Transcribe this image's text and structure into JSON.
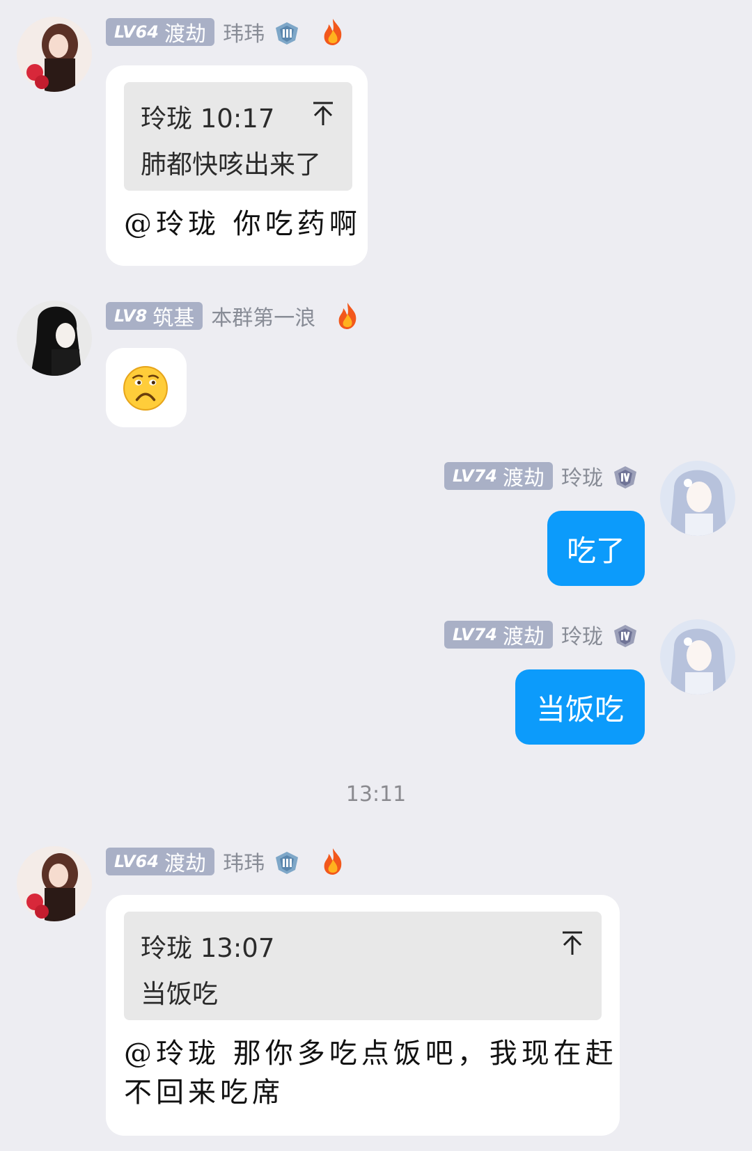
{
  "messages": [
    {
      "level_prefix": "LV64",
      "level_title": "渡劫",
      "nickname": "玮玮",
      "quote": {
        "author_time": "玲珑 10:17",
        "text": "肺都快咳出来了"
      },
      "text": "@玲珑 你吃药啊"
    },
    {
      "level_prefix": "LV8",
      "level_title": "筑基",
      "nickname": "本群第一浪",
      "emoji": "sad-face"
    },
    {
      "level_prefix": "LV74",
      "level_title": "渡劫",
      "nickname": "玲珑",
      "text": "吃了"
    },
    {
      "level_prefix": "LV74",
      "level_title": "渡劫",
      "nickname": "玲珑",
      "text": "当饭吃"
    },
    {
      "level_prefix": "LV64",
      "level_title": "渡劫",
      "nickname": "玮玮",
      "quote": {
        "author_time": "玲珑 13:07",
        "text": "当饭吃"
      },
      "text_line1": "@玲珑 那你多吃点饭吧，我现在赶",
      "text_line2": "不回来吃席"
    }
  ],
  "timestamp": "13:11",
  "colors": {
    "background": "#ededf2",
    "level_badge": "#a9b0c6",
    "outgoing_bubble": "#0c9bfb"
  }
}
